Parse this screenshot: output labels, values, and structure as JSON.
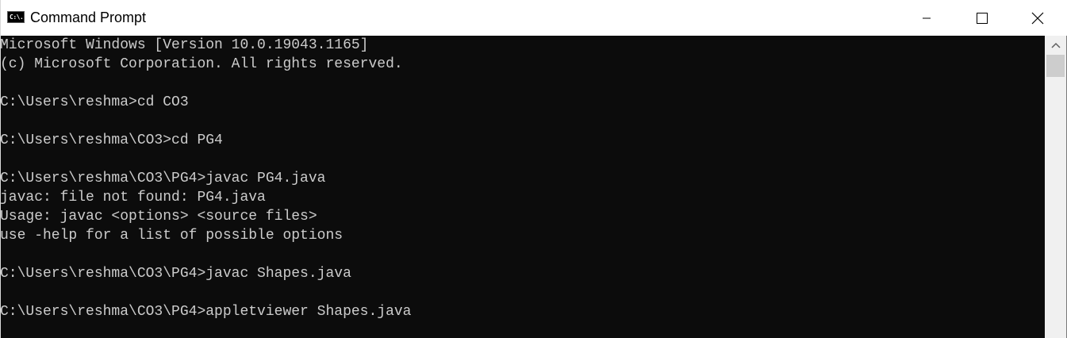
{
  "window": {
    "title": "Command Prompt",
    "icon": "cmd-icon",
    "icon_text": "C:\\."
  },
  "controls": {
    "minimize_icon": "minimize-icon",
    "maximize_icon": "maximize-icon",
    "close_icon": "close-icon"
  },
  "console": {
    "background": "#0c0c0c",
    "foreground": "#cccccc",
    "lines": [
      "Microsoft Windows [Version 10.0.19043.1165]",
      "(c) Microsoft Corporation. All rights reserved.",
      "",
      "C:\\Users\\reshma>cd CO3",
      "",
      "C:\\Users\\reshma\\CO3>cd PG4",
      "",
      "C:\\Users\\reshma\\CO3\\PG4>javac PG4.java",
      "javac: file not found: PG4.java",
      "Usage: javac <options> <source files>",
      "use -help for a list of possible options",
      "",
      "C:\\Users\\reshma\\CO3\\PG4>javac Shapes.java",
      "",
      "C:\\Users\\reshma\\CO3\\PG4>appletviewer Shapes.java"
    ]
  },
  "scrollbar": {
    "up_icon": "scroll-up-arrow-icon"
  }
}
